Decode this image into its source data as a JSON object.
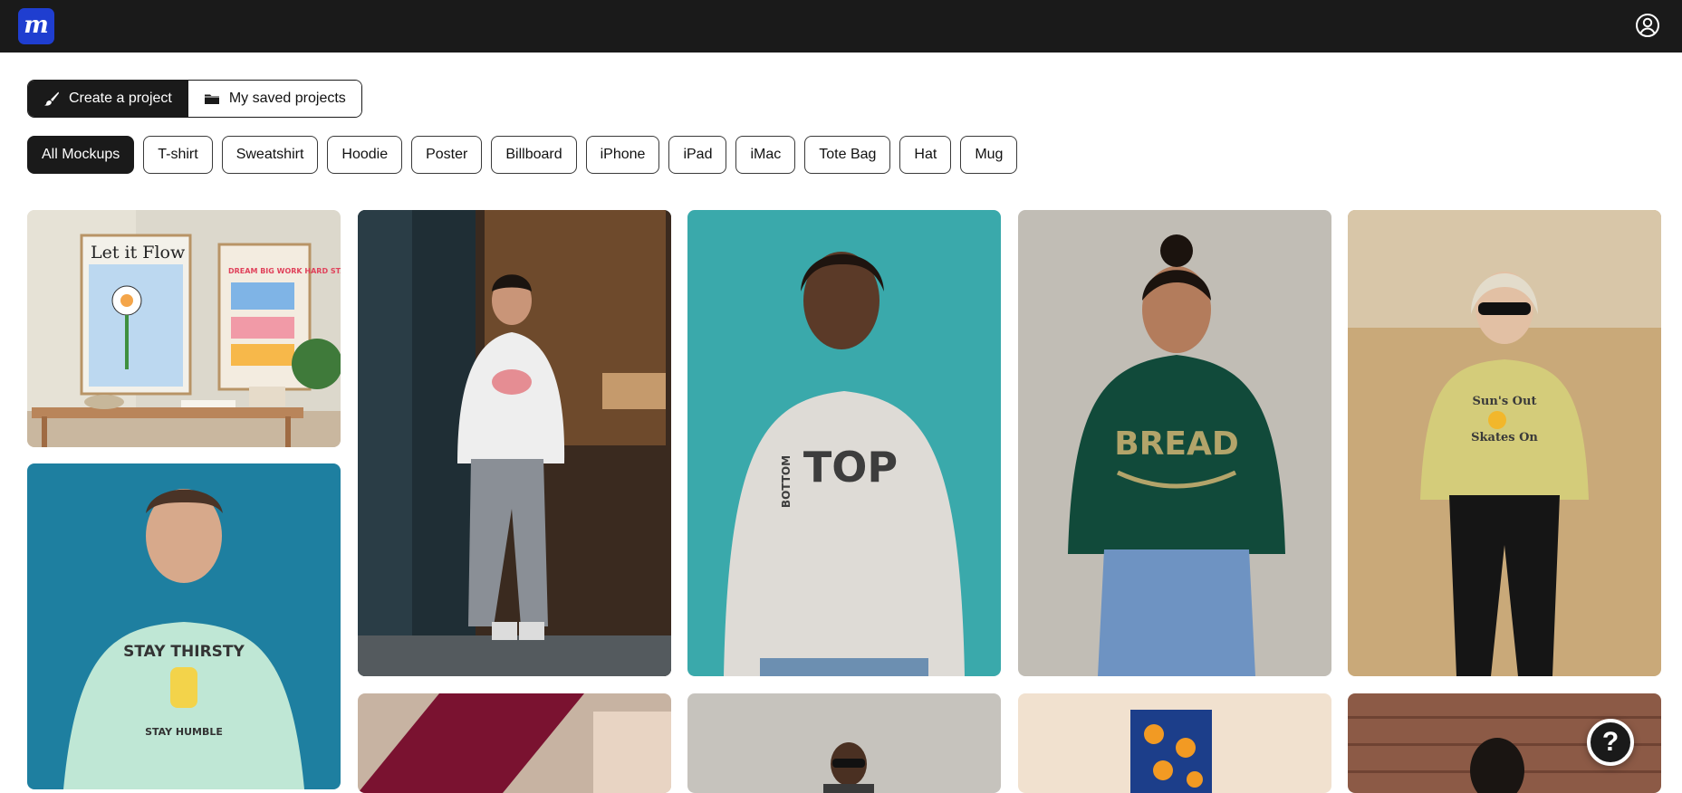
{
  "app": {
    "logo_letter": "m",
    "brand_color": "#1f3ed0",
    "account_icon": "user-circle-icon"
  },
  "project_toggle": {
    "create_label": "Create a project",
    "create_icon": "paintbrush-icon",
    "saved_label": "My saved projects",
    "saved_icon": "folder-icon"
  },
  "filters": [
    "All Mockups",
    "T-shirt",
    "Sweatshirt",
    "Hoodie",
    "Poster",
    "Billboard",
    "iPhone",
    "iPad",
    "iMac",
    "Tote Bag",
    "Hat",
    "Mug"
  ],
  "active_filter": "All Mockups",
  "gallery": {
    "items": [
      {
        "caption": "Let it Flow",
        "caption2": "DREAM BIG WORK HARD STAY HUMBLE",
        "kind": "poster"
      },
      {
        "caption": "STAY THIRSTY",
        "caption2": "STAY HUMBLE",
        "kind": "sweatshirt"
      },
      {
        "caption": "",
        "kind": "sweatshirt"
      },
      {
        "caption": "BOTTOM",
        "caption2": "TOP",
        "kind": "sweatshirt"
      },
      {
        "caption": "BREAD",
        "kind": "sweatshirt"
      },
      {
        "caption": "Sun's Out",
        "caption2": "Skates On",
        "kind": "sweatshirt"
      },
      {
        "caption": "",
        "kind": "fabric"
      },
      {
        "caption": "",
        "kind": "model"
      },
      {
        "caption": "",
        "kind": "poster"
      },
      {
        "caption": "",
        "kind": "model"
      }
    ]
  },
  "help": {
    "label": "?",
    "icon": "help-icon"
  }
}
